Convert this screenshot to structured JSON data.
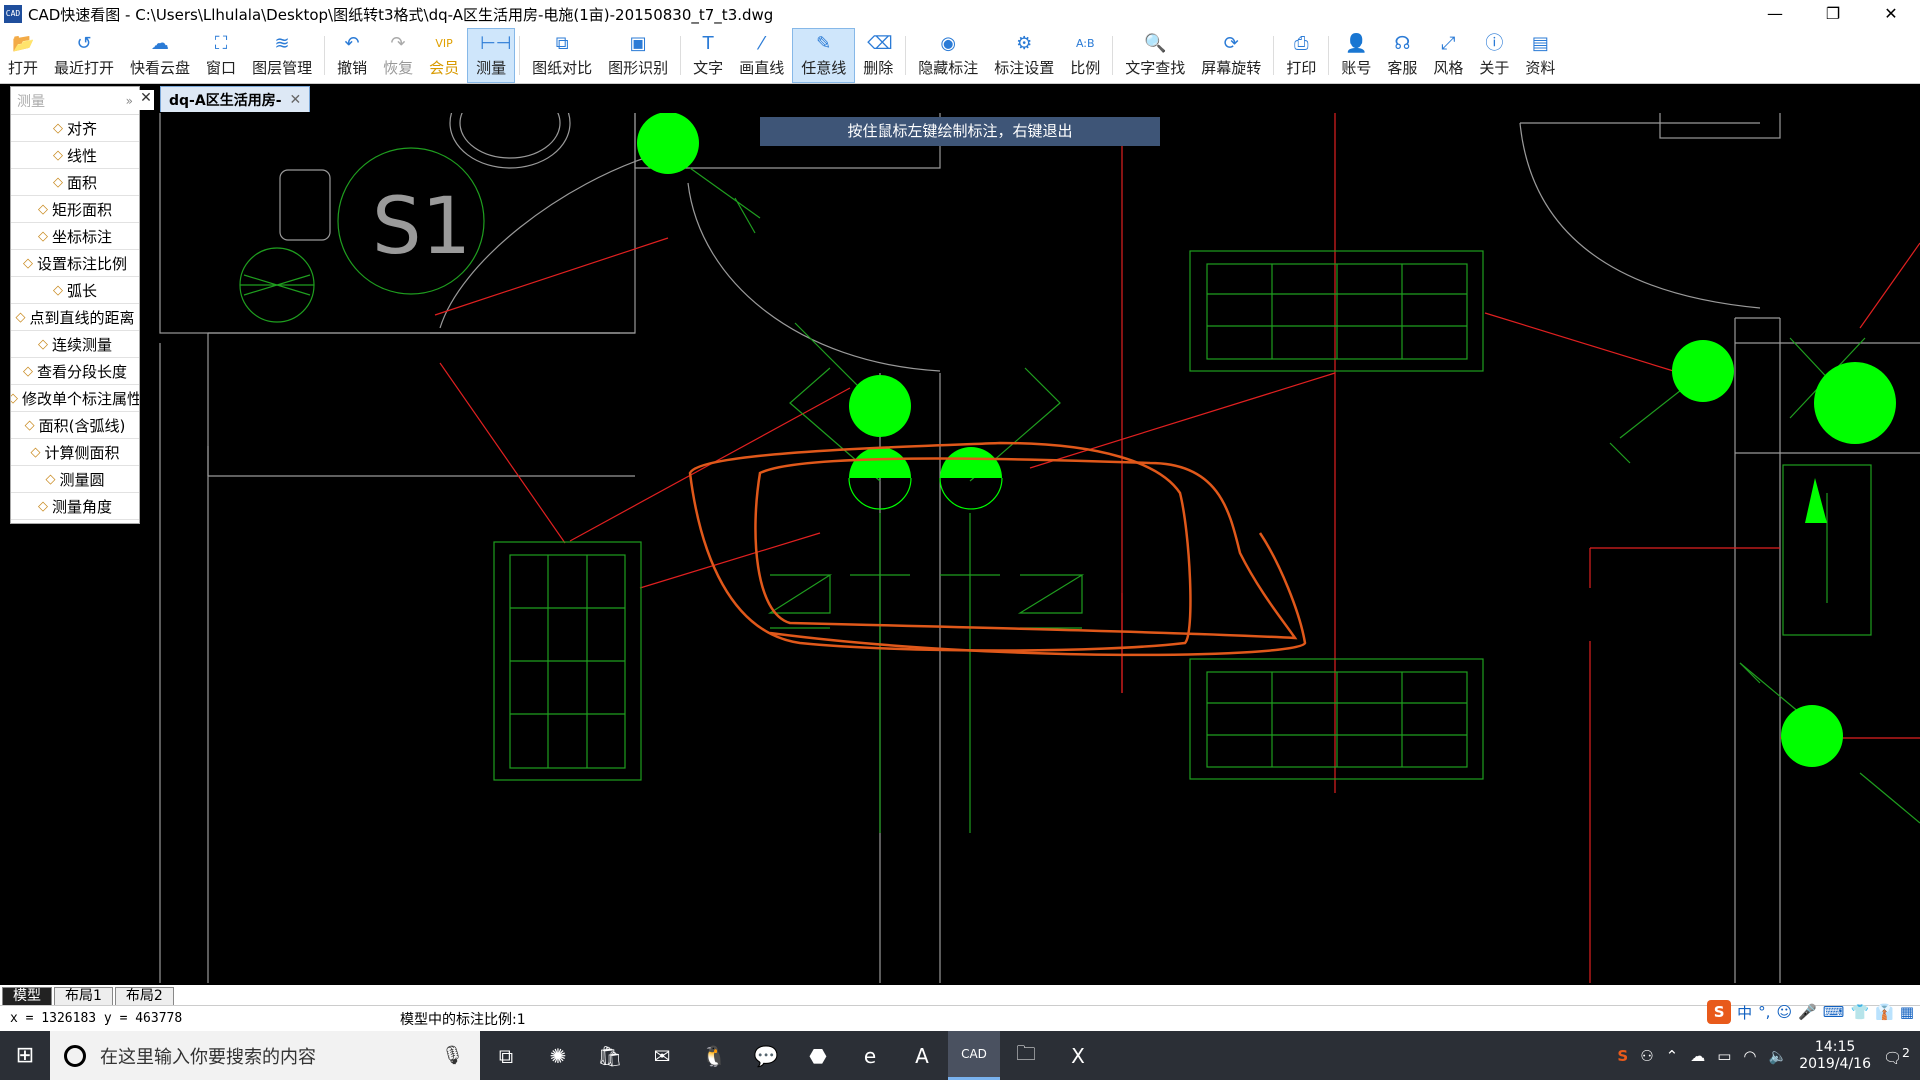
{
  "window": {
    "title": "CAD快速看图 - C:\\Users\\Llhulala\\Desktop\\图纸转t3格式\\dq-A区生活用房-电施(1亩)-20150830_t7_t3.dwg",
    "app_icon": "CAD",
    "min": "—",
    "max": "❐",
    "close": "✕"
  },
  "toolbar": [
    {
      "label": "打开",
      "icon": "folder-open-icon",
      "glyph": "📂"
    },
    {
      "label": "最近打开",
      "icon": "history-icon",
      "glyph": "↺"
    },
    {
      "label": "快看云盘",
      "icon": "cloud-icon",
      "glyph": "☁"
    },
    {
      "label": "窗口",
      "icon": "window-icon",
      "glyph": "⛶"
    },
    {
      "label": "图层管理",
      "icon": "layers-icon",
      "glyph": "≋"
    },
    {
      "label": "撤销",
      "icon": "undo-icon",
      "glyph": "↶"
    },
    {
      "label": "恢复",
      "icon": "redo-icon",
      "glyph": "↷",
      "disabled": true
    },
    {
      "label": "会员",
      "icon": "vip-icon",
      "glyph": "VIP",
      "vip": true
    },
    {
      "label": "测量",
      "icon": "measure-icon",
      "glyph": "⊢⊣",
      "active": true
    },
    {
      "label": "图纸对比",
      "icon": "compare-icon",
      "glyph": "⧉"
    },
    {
      "label": "图形识别",
      "icon": "shape-recognize-icon",
      "glyph": "▣"
    },
    {
      "label": "文字",
      "icon": "text-icon",
      "glyph": "T"
    },
    {
      "label": "画直线",
      "icon": "line-icon",
      "glyph": "⁄"
    },
    {
      "label": "任意线",
      "icon": "freehand-icon",
      "glyph": "✎",
      "active": true
    },
    {
      "label": "删除",
      "icon": "eraser-icon",
      "glyph": "⌫"
    },
    {
      "label": "隐藏标注",
      "icon": "hide-icon",
      "glyph": "◉"
    },
    {
      "label": "标注设置",
      "icon": "annotation-settings-icon",
      "glyph": "⚙"
    },
    {
      "label": "比例",
      "icon": "scale-icon",
      "glyph": "A:B"
    },
    {
      "label": "文字查找",
      "icon": "text-search-icon",
      "glyph": "🔍"
    },
    {
      "label": "屏幕旋转",
      "icon": "rotate-icon",
      "glyph": "⟳"
    },
    {
      "label": "打印",
      "icon": "print-icon",
      "glyph": "⎙"
    },
    {
      "label": "账号",
      "icon": "account-icon",
      "glyph": "👤"
    },
    {
      "label": "客服",
      "icon": "headset-icon",
      "glyph": "☊"
    },
    {
      "label": "风格",
      "icon": "style-icon",
      "glyph": "⤢"
    },
    {
      "label": "关于",
      "icon": "info-icon",
      "glyph": "ⓘ"
    },
    {
      "label": "资料",
      "icon": "resources-icon",
      "glyph": "▤"
    }
  ],
  "doc_tab": {
    "label": "dq-A区生活用房-",
    "close": "✕"
  },
  "hint": "按住鼠标左键绘制标注，右键退出",
  "measure_panel": {
    "title": "测量",
    "pin": "»",
    "close": "✕",
    "items": [
      {
        "label": "对齐",
        "icon": "align-measure-icon"
      },
      {
        "label": "线性",
        "icon": "linear-measure-icon"
      },
      {
        "label": "面积",
        "icon": "area-icon"
      },
      {
        "label": "矩形面积",
        "icon": "rect-area-icon"
      },
      {
        "label": "坐标标注",
        "icon": "coordinate-icon"
      },
      {
        "label": "设置标注比例",
        "icon": "scale-setting-icon"
      },
      {
        "label": "弧长",
        "icon": "arc-length-icon"
      },
      {
        "label": "点到直线的距离",
        "icon": "point-line-distance-icon"
      },
      {
        "label": "连续测量",
        "icon": "continuous-measure-icon"
      },
      {
        "label": "查看分段长度",
        "icon": "segment-length-icon"
      },
      {
        "label": "修改单个标注属性",
        "icon": "edit-annotation-icon"
      },
      {
        "label": "面积(含弧线)",
        "icon": "area-arc-icon"
      },
      {
        "label": "计算侧面积",
        "icon": "side-area-icon"
      },
      {
        "label": "测量圆",
        "icon": "circle-measure-icon"
      },
      {
        "label": "测量角度",
        "icon": "angle-measure-icon"
      }
    ]
  },
  "drawing": {
    "room_label": "S1",
    "colors": {
      "green": "#00ff00",
      "dark_green": "#1f9e1f",
      "red": "#e02020",
      "gray": "#9a9a9a",
      "annotation": "#e0581a",
      "white": "#ffffff"
    }
  },
  "layout_tabs": [
    "模型",
    "布局1",
    "布局2"
  ],
  "status": {
    "coords": "x = 1326183  y = 463778",
    "ratio": "模型中的标注比例:1"
  },
  "ime": [
    "S",
    "中",
    "°,",
    "☺",
    "🎤",
    "⌨",
    "👕",
    "👔",
    "▦"
  ],
  "taskbar": {
    "search_placeholder": "在这里输入你要搜索的内容",
    "apps": [
      {
        "name": "task-view-icon",
        "glyph": "⧉"
      },
      {
        "name": "swirl-app-icon",
        "glyph": "✺"
      },
      {
        "name": "store-icon",
        "glyph": "🛍"
      },
      {
        "name": "mail-icon",
        "glyph": "✉"
      },
      {
        "name": "qq-icon",
        "glyph": "🐧"
      },
      {
        "name": "wechat-icon",
        "glyph": "💬"
      },
      {
        "name": "green-app-icon",
        "glyph": "⬣"
      },
      {
        "name": "edge-icon",
        "glyph": "e"
      },
      {
        "name": "a-app-icon",
        "glyph": "A"
      },
      {
        "name": "cad-app-icon",
        "glyph": "CAD",
        "active": true
      },
      {
        "name": "file-explorer-icon",
        "glyph": "🗀"
      },
      {
        "name": "excel-icon",
        "glyph": "X"
      }
    ],
    "tray": {
      "sogou": "S",
      "time": "14:15",
      "date": "2019/4/16",
      "notifications": "2"
    }
  }
}
